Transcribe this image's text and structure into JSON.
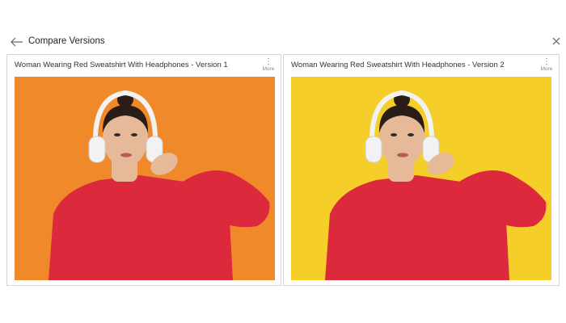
{
  "header": {
    "title": "Compare Versions",
    "back_icon": "arrow-left-icon",
    "close_icon": "close-icon"
  },
  "versions": [
    {
      "title": "Woman Wearing Red Sweatshirt With Headphones - Version 1",
      "more_label": "More",
      "background_color": "#f0892a"
    },
    {
      "title": "Woman Wearing Red Sweatshirt With Headphones - Version 2",
      "more_label": "More",
      "background_color": "#f5ce2a"
    }
  ],
  "colors": {
    "sweatshirt": "#dc2a3c",
    "skin": "#e6b998",
    "hair": "#2a1d17",
    "headphones": "#f2f2f2"
  }
}
